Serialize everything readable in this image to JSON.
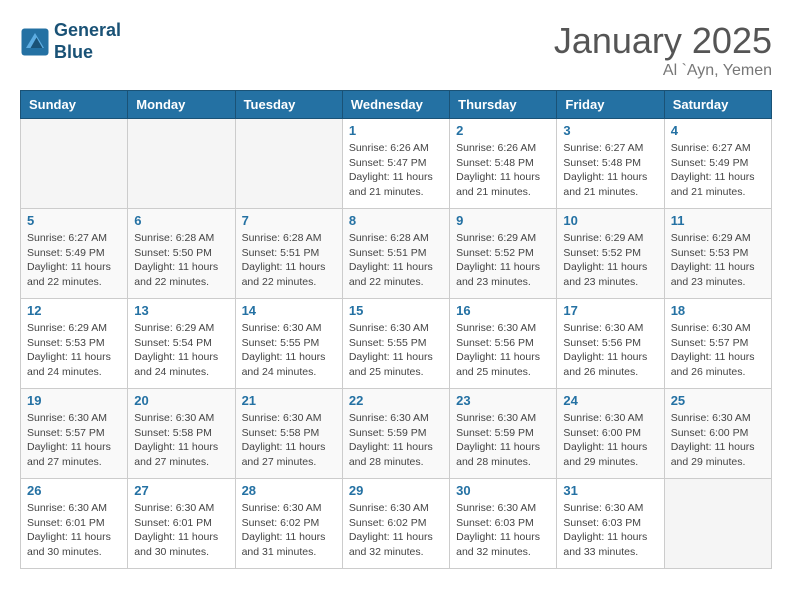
{
  "logo": {
    "line1": "General",
    "line2": "Blue"
  },
  "title": "January 2025",
  "location": "Al `Ayn, Yemen",
  "days_of_week": [
    "Sunday",
    "Monday",
    "Tuesday",
    "Wednesday",
    "Thursday",
    "Friday",
    "Saturday"
  ],
  "weeks": [
    [
      {
        "num": "",
        "info": ""
      },
      {
        "num": "",
        "info": ""
      },
      {
        "num": "",
        "info": ""
      },
      {
        "num": "1",
        "info": "Sunrise: 6:26 AM\nSunset: 5:47 PM\nDaylight: 11 hours\nand 21 minutes."
      },
      {
        "num": "2",
        "info": "Sunrise: 6:26 AM\nSunset: 5:48 PM\nDaylight: 11 hours\nand 21 minutes."
      },
      {
        "num": "3",
        "info": "Sunrise: 6:27 AM\nSunset: 5:48 PM\nDaylight: 11 hours\nand 21 minutes."
      },
      {
        "num": "4",
        "info": "Sunrise: 6:27 AM\nSunset: 5:49 PM\nDaylight: 11 hours\nand 21 minutes."
      }
    ],
    [
      {
        "num": "5",
        "info": "Sunrise: 6:27 AM\nSunset: 5:49 PM\nDaylight: 11 hours\nand 22 minutes."
      },
      {
        "num": "6",
        "info": "Sunrise: 6:28 AM\nSunset: 5:50 PM\nDaylight: 11 hours\nand 22 minutes."
      },
      {
        "num": "7",
        "info": "Sunrise: 6:28 AM\nSunset: 5:51 PM\nDaylight: 11 hours\nand 22 minutes."
      },
      {
        "num": "8",
        "info": "Sunrise: 6:28 AM\nSunset: 5:51 PM\nDaylight: 11 hours\nand 22 minutes."
      },
      {
        "num": "9",
        "info": "Sunrise: 6:29 AM\nSunset: 5:52 PM\nDaylight: 11 hours\nand 23 minutes."
      },
      {
        "num": "10",
        "info": "Sunrise: 6:29 AM\nSunset: 5:52 PM\nDaylight: 11 hours\nand 23 minutes."
      },
      {
        "num": "11",
        "info": "Sunrise: 6:29 AM\nSunset: 5:53 PM\nDaylight: 11 hours\nand 23 minutes."
      }
    ],
    [
      {
        "num": "12",
        "info": "Sunrise: 6:29 AM\nSunset: 5:53 PM\nDaylight: 11 hours\nand 24 minutes."
      },
      {
        "num": "13",
        "info": "Sunrise: 6:29 AM\nSunset: 5:54 PM\nDaylight: 11 hours\nand 24 minutes."
      },
      {
        "num": "14",
        "info": "Sunrise: 6:30 AM\nSunset: 5:55 PM\nDaylight: 11 hours\nand 24 minutes."
      },
      {
        "num": "15",
        "info": "Sunrise: 6:30 AM\nSunset: 5:55 PM\nDaylight: 11 hours\nand 25 minutes."
      },
      {
        "num": "16",
        "info": "Sunrise: 6:30 AM\nSunset: 5:56 PM\nDaylight: 11 hours\nand 25 minutes."
      },
      {
        "num": "17",
        "info": "Sunrise: 6:30 AM\nSunset: 5:56 PM\nDaylight: 11 hours\nand 26 minutes."
      },
      {
        "num": "18",
        "info": "Sunrise: 6:30 AM\nSunset: 5:57 PM\nDaylight: 11 hours\nand 26 minutes."
      }
    ],
    [
      {
        "num": "19",
        "info": "Sunrise: 6:30 AM\nSunset: 5:57 PM\nDaylight: 11 hours\nand 27 minutes."
      },
      {
        "num": "20",
        "info": "Sunrise: 6:30 AM\nSunset: 5:58 PM\nDaylight: 11 hours\nand 27 minutes."
      },
      {
        "num": "21",
        "info": "Sunrise: 6:30 AM\nSunset: 5:58 PM\nDaylight: 11 hours\nand 27 minutes."
      },
      {
        "num": "22",
        "info": "Sunrise: 6:30 AM\nSunset: 5:59 PM\nDaylight: 11 hours\nand 28 minutes."
      },
      {
        "num": "23",
        "info": "Sunrise: 6:30 AM\nSunset: 5:59 PM\nDaylight: 11 hours\nand 28 minutes."
      },
      {
        "num": "24",
        "info": "Sunrise: 6:30 AM\nSunset: 6:00 PM\nDaylight: 11 hours\nand 29 minutes."
      },
      {
        "num": "25",
        "info": "Sunrise: 6:30 AM\nSunset: 6:00 PM\nDaylight: 11 hours\nand 29 minutes."
      }
    ],
    [
      {
        "num": "26",
        "info": "Sunrise: 6:30 AM\nSunset: 6:01 PM\nDaylight: 11 hours\nand 30 minutes."
      },
      {
        "num": "27",
        "info": "Sunrise: 6:30 AM\nSunset: 6:01 PM\nDaylight: 11 hours\nand 30 minutes."
      },
      {
        "num": "28",
        "info": "Sunrise: 6:30 AM\nSunset: 6:02 PM\nDaylight: 11 hours\nand 31 minutes."
      },
      {
        "num": "29",
        "info": "Sunrise: 6:30 AM\nSunset: 6:02 PM\nDaylight: 11 hours\nand 32 minutes."
      },
      {
        "num": "30",
        "info": "Sunrise: 6:30 AM\nSunset: 6:03 PM\nDaylight: 11 hours\nand 32 minutes."
      },
      {
        "num": "31",
        "info": "Sunrise: 6:30 AM\nSunset: 6:03 PM\nDaylight: 11 hours\nand 33 minutes."
      },
      {
        "num": "",
        "info": ""
      }
    ]
  ]
}
